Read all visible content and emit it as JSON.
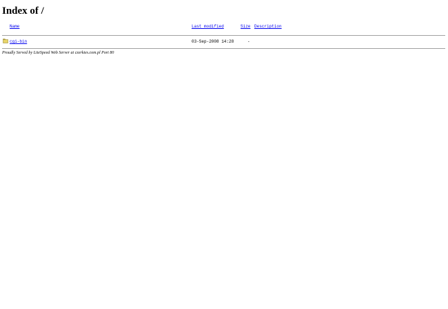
{
  "page": {
    "title": "Index of /"
  },
  "table": {
    "columns": {
      "name": "Name",
      "last_modified": "Last modified",
      "size": "Size",
      "description": "Description"
    },
    "rows": [
      {
        "icon": "folder-icon",
        "name": "cgi-bin",
        "last_modified": "03-Sep-2008 14:28",
        "size": "-",
        "description": ""
      }
    ]
  },
  "footer": {
    "text": "Proudly Served by LiteSpeed Web Server at czerkies.com.pl Port 80"
  },
  "colors": {
    "link": "#0000ee",
    "folder": "#e8d46a",
    "rule": "#a0a0a0"
  }
}
